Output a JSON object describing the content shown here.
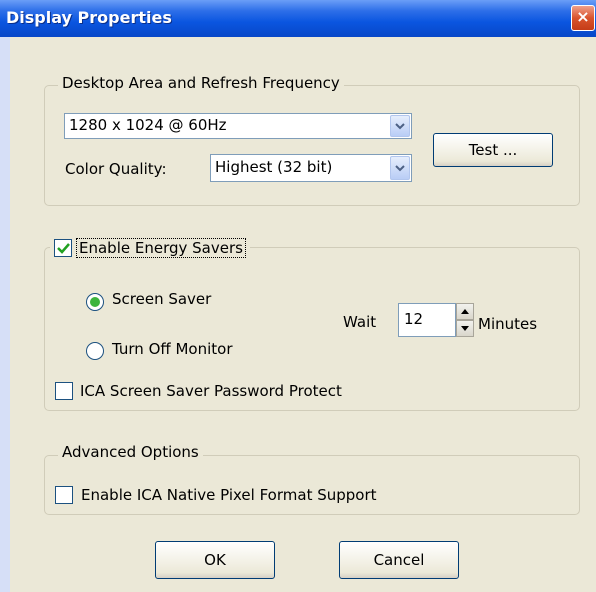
{
  "window": {
    "title": "Display Properties",
    "close_glyph": "×"
  },
  "display_group": {
    "legend": "Desktop Area and Refresh Frequency",
    "resolution": {
      "value": "1280 x 1024 @ 60Hz"
    },
    "color_quality": {
      "label": "Color Quality:",
      "value": "Highest (32 bit)"
    },
    "test_button": "Test ..."
  },
  "energy_group": {
    "legend": "Enable Energy Savers",
    "checked": true,
    "screen_saver": {
      "label": "Screen Saver",
      "selected": true
    },
    "turn_off_monitor": {
      "label": "Turn Off Monitor",
      "selected": false
    },
    "wait_label": "Wait",
    "wait_value": "12",
    "minutes_label": "Minutes",
    "password_protect": {
      "label": "ICA Screen Saver Password Protect",
      "checked": false
    }
  },
  "advanced_group": {
    "legend": "Advanced Options",
    "native_pixel": {
      "label": "Enable ICA Native Pixel Format Support",
      "checked": false
    }
  },
  "buttons": {
    "ok": "OK",
    "cancel": "Cancel"
  },
  "colors": {
    "titlebar": "#0a55e0",
    "dialog_bg": "#ebe8d7",
    "check_mark": "#21a121"
  }
}
